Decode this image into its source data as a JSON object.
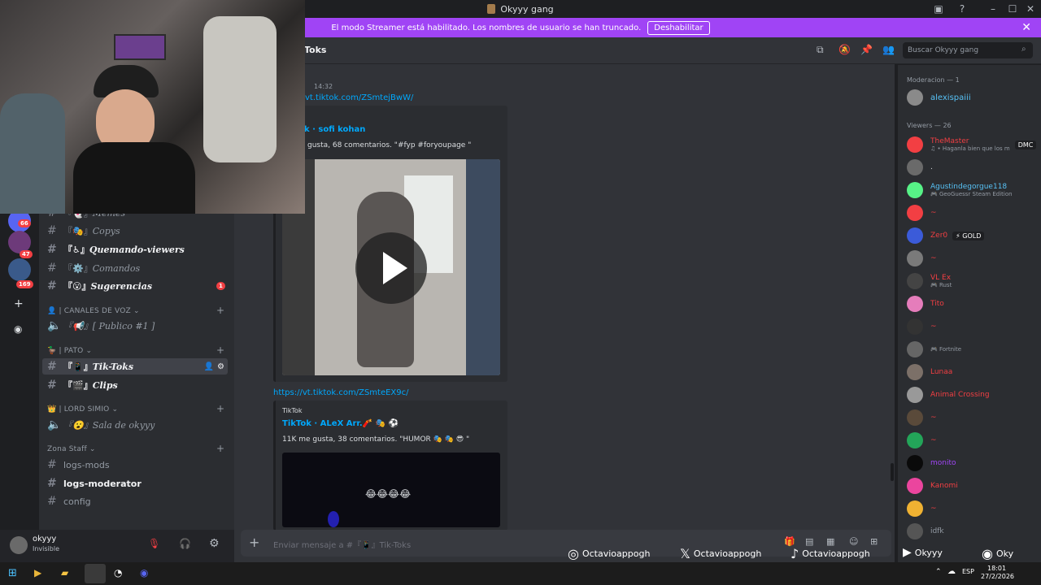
{
  "window": {
    "title": "Okyyy gang"
  },
  "banner": {
    "text": "El modo Streamer está habilitado. Los nombres de usuario se han truncado.",
    "button": "Deshabilitar"
  },
  "header": {
    "channel": "Toks",
    "search_placeholder": "Buscar Okyyy gang"
  },
  "guild_badges": [
    "66",
    "47",
    "169"
  ],
  "channels": [
    {
      "label": "Memes",
      "prefix": "『👻』",
      "style": "em",
      "unread": false
    },
    {
      "label": "Copys",
      "prefix": "『🎭』",
      "style": "em",
      "unread": false
    },
    {
      "label": "Quemando-viewers",
      "prefix": "『♿』",
      "style": "em",
      "unread": true
    },
    {
      "label": "Comandos",
      "prefix": "『⚙️』",
      "style": "em",
      "unread": false
    },
    {
      "label": "Sugerencias",
      "prefix": "『😮』",
      "style": "em",
      "unread": true,
      "badge": "1"
    }
  ],
  "categories": {
    "voz": "| CANALES DE VOZ",
    "pato": "| PATO",
    "lord": "| LORD SIMIO",
    "staff": "Zona Staff"
  },
  "voice_publico": "『📢』[ Publico #1 ]",
  "pato_channels": [
    {
      "label": "Tik-Toks",
      "prefix": "『📱』"
    },
    {
      "label": "Clips",
      "prefix": "『🎬』"
    }
  ],
  "lord_channel": "『😮』Sala de okyyy",
  "staff_channels": [
    "logs-mods",
    "logs-moderator",
    "config"
  ],
  "user": {
    "name": "okyyy",
    "status": "Invisible"
  },
  "messages": {
    "time": "14:32",
    "link1": "vt.tiktok.com/ZSmtejBwW/",
    "embed1_author": "k · sofi kohan",
    "embed1_desc": "gusta, 68 comentarios. \"#fyp #foryoupage \"",
    "link2": "https://vt.tiktok.com/ZSmteEX9c/",
    "embed2_provider": "TikTok",
    "embed2_author": "TikTok · ALeX Arr.🧨 🎭 ⚽",
    "embed2_desc": "11K me gusta, 38 comentarios. \"HUMOR 🎭 🎭 😎 \"",
    "embed2_emojis": "😂😂😂😂"
  },
  "composer": {
    "placeholder": "Enviar mensaje a #『📱』Tik-Toks"
  },
  "members": {
    "mod_header": "Moderacion — 1",
    "mod_name": "alexispaiii",
    "viewers_header": "Viewers — 26",
    "list": [
      {
        "name": "TheMaster",
        "sub": "♫ • Hagan​la bien que los m",
        "tag": "DMC",
        "color": "#f23f43"
      },
      {
        "name": ".",
        "sub": "",
        "color": "#dbdee1"
      },
      {
        "name": "Agustindegorgue118",
        "sub": "🎮 GeoGuessr Steam Edition",
        "color": "#57c1f5"
      },
      {
        "name": "~",
        "sub": "",
        "color": "#f23f43"
      },
      {
        "name": "Zer0",
        "sub": "",
        "tag": "⚡ GOLD",
        "color": "#f23f43"
      },
      {
        "name": "~",
        "sub": "",
        "color": "#f23f43"
      },
      {
        "name": "VL Ex",
        "sub": "🎮 Rust",
        "color": "#f23f43"
      },
      {
        "name": "Tito",
        "sub": "",
        "color": "#f23f43"
      },
      {
        "name": "~",
        "sub": "",
        "color": "#f23f43"
      },
      {
        "name": "",
        "sub": "🎮 Fortnite",
        "color": "#f23f43"
      },
      {
        "name": "Lunaa",
        "sub": "",
        "color": "#f23f43"
      },
      {
        "name": "Animal Crossing",
        "sub": "",
        "color": "#f23f43"
      },
      {
        "name": "~",
        "sub": "",
        "color": "#f23f43"
      },
      {
        "name": "~",
        "sub": "",
        "color": "#f23f43"
      },
      {
        "name": "monito",
        "sub": "",
        "color": "#a044f5"
      },
      {
        "name": "Kanomi",
        "sub": "",
        "color": "#f23f43"
      },
      {
        "name": "~",
        "sub": "",
        "color": "#f23f43"
      },
      {
        "name": "idfk",
        "sub": "",
        "color": "#949ba4"
      }
    ]
  },
  "socials": [
    "Octavioappogh",
    "Octavioappogh",
    "Octavioappogh",
    "Okyyy",
    "Oky"
  ],
  "tray": {
    "lang": "ESP",
    "time": "18:01",
    "date": "27/2/2026"
  },
  "colors": {
    "accent": "#a044f5",
    "link": "#00a8fc",
    "bg": "#313338"
  }
}
